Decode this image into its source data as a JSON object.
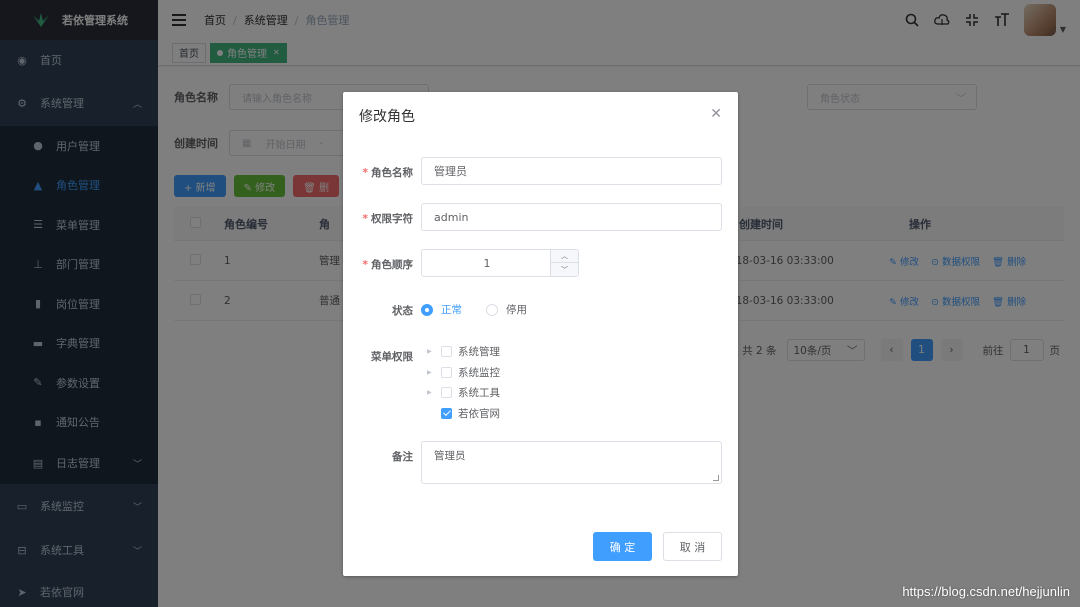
{
  "sidebar": {
    "logo_text": "若依管理系统",
    "items": [
      {
        "label": "首页",
        "icon": "dashboard-icon"
      },
      {
        "label": "系统管理",
        "icon": "gear-icon"
      },
      {
        "label": "用户管理",
        "icon": "user-icon"
      },
      {
        "label": "角色管理",
        "icon": "role-icon"
      },
      {
        "label": "菜单管理",
        "icon": "tree-table-icon"
      },
      {
        "label": "部门管理",
        "icon": "tree-icon"
      },
      {
        "label": "岗位管理",
        "icon": "post-icon"
      },
      {
        "label": "字典管理",
        "icon": "dict-icon"
      },
      {
        "label": "参数设置",
        "icon": "edit-icon"
      },
      {
        "label": "通知公告",
        "icon": "message-icon"
      },
      {
        "label": "日志管理",
        "icon": "log-icon"
      },
      {
        "label": "系统监控",
        "icon": "monitor-icon"
      },
      {
        "label": "系统工具",
        "icon": "tool-icon"
      },
      {
        "label": "若依官网",
        "icon": "guide-icon"
      }
    ]
  },
  "navbar": {
    "breadcrumb": [
      "首页",
      "系统管理",
      "角色管理"
    ]
  },
  "tags": {
    "home": "首页",
    "active": "角色管理"
  },
  "search": {
    "role_name_label": "角色名称",
    "role_name_placeholder": "请输入角色名称",
    "status_placeholder": "角色状态",
    "create_time_label": "创建时间",
    "start_date_placeholder": "开始日期"
  },
  "toolbar": {
    "add": "+ 新增",
    "edit": "✎ 修改",
    "delete": "🗑 删"
  },
  "table": {
    "headers": [
      "角色编号",
      "角",
      "创建时间",
      "操作"
    ],
    "rows": [
      {
        "id": "1",
        "name": "管理",
        "time": "018-03-16 03:33:00"
      },
      {
        "id": "2",
        "name": "普通",
        "time": "018-03-16 03:33:00"
      }
    ],
    "actions": [
      "修改",
      "数据权限",
      "删除"
    ]
  },
  "pagination": {
    "total": "共 2 条",
    "page_size": "10条/页",
    "current": "1",
    "goto_label": "前往",
    "goto_value": "1",
    "page_suffix": "页"
  },
  "dialog": {
    "title": "修改角色",
    "fields": {
      "role_name_label": "角色名称",
      "role_name_value": "管理员",
      "role_key_label": "权限字符",
      "role_key_value": "admin",
      "role_sort_label": "角色顺序",
      "role_sort_value": "1",
      "status_label": "状态",
      "status_normal": "正常",
      "status_disabled": "停用",
      "menu_label": "菜单权限",
      "menu_nodes": [
        {
          "label": "系统管理",
          "checked": false,
          "expandable": true
        },
        {
          "label": "系统监控",
          "checked": false,
          "expandable": true
        },
        {
          "label": "系统工具",
          "checked": false,
          "expandable": true
        },
        {
          "label": "若依官网",
          "checked": true,
          "expandable": false
        }
      ],
      "remark_label": "备注",
      "remark_value": "管理员"
    },
    "confirm": "确 定",
    "cancel": "取 消"
  },
  "watermark": "https://blog.csdn.net/hejjunlin",
  "colors": {
    "sidebar_bg": "#304156",
    "primary": "#409eff",
    "success": "#42b983",
    "danger": "#f56c6c"
  }
}
